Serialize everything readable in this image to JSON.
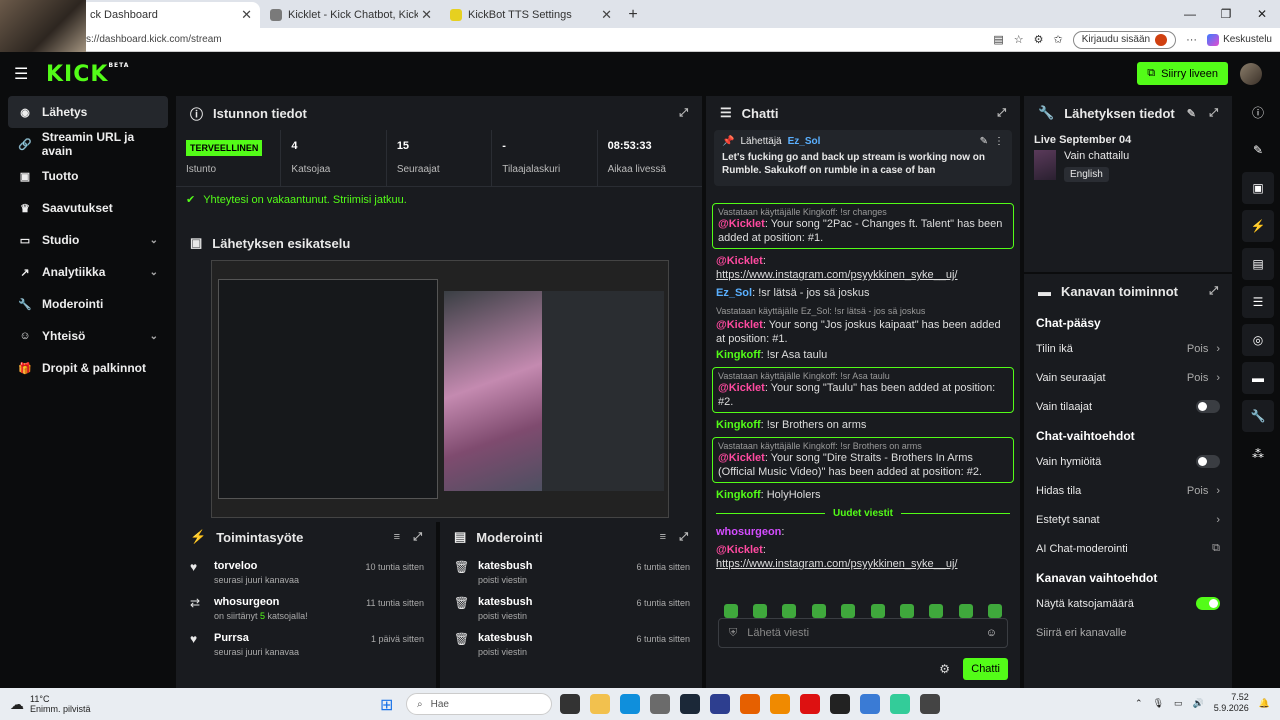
{
  "browser": {
    "tabs": [
      {
        "label": "ck Dashboard",
        "active": true
      },
      {
        "label": "Kicklet - Kick Chatbot, Kick Widge",
        "active": false
      },
      {
        "label": "KickBot TTS Settings",
        "active": false
      }
    ],
    "url": "s://dashboard.kick.com/stream",
    "signin_label": "Kirjaudu sisään",
    "copilot_label": "Keskustelu"
  },
  "topnav": {
    "logo": "KICK",
    "logo_sup": "BETA",
    "golive_label": "Siirry liveen"
  },
  "sidebar": {
    "items": [
      {
        "label": "Lähetys",
        "icon": "broadcast-icon",
        "active": true
      },
      {
        "label": "Streamin URL ja avain",
        "icon": "link-icon"
      },
      {
        "label": "Tuotto",
        "icon": "wallet-icon"
      },
      {
        "label": "Saavutukset",
        "icon": "trophy-icon"
      },
      {
        "label": "Studio",
        "icon": "studio-icon",
        "chevron": true
      },
      {
        "label": "Analytiikka",
        "icon": "analytics-icon",
        "chevron": true
      },
      {
        "label": "Moderointi",
        "icon": "wrench-icon"
      },
      {
        "label": "Yhteisö",
        "icon": "community-icon",
        "chevron": true
      },
      {
        "label": "Dropit & palkinnot",
        "icon": "gift-icon"
      }
    ]
  },
  "session": {
    "title": "Istunnon tiedot",
    "health_badge": "TERVEELLINEN",
    "health_label": "Istunto",
    "viewers_value": "4",
    "viewers_label": "Katsojaa",
    "followers_value": "15",
    "followers_label": "Seuraajat",
    "subs_value": "-",
    "subs_label": "Tilaajalaskuri",
    "live_time_value": "08:53:33",
    "live_time_label": "Aikaa livessä",
    "status_text": "Yhteytesi on vakaantunut. Striimisi jatkuu."
  },
  "preview": {
    "title": "Lähetyksen esikatselu"
  },
  "activity": {
    "title": "Toimintasyöte",
    "items": [
      {
        "name": "torveloo",
        "sub": "seurasi juuri kanavaa",
        "time": "10 tuntia sitten"
      },
      {
        "name": "whosurgeon",
        "sub_pre": "on siirtänyt ",
        "sub_count": "5",
        "sub_post": " katsojalla!",
        "time": "11 tuntia sitten"
      },
      {
        "name": "Purrsa",
        "sub": "seurasi juuri kanavaa",
        "time": "1 päivä sitten"
      }
    ]
  },
  "moderation": {
    "title": "Moderointi",
    "items": [
      {
        "name": "katesbush",
        "sub": "poisti viestin",
        "time": "6 tuntia sitten"
      },
      {
        "name": "katesbush",
        "sub": "poisti viestin",
        "time": "6 tuntia sitten"
      },
      {
        "name": "katesbush",
        "sub": "poisti viestin",
        "time": "6 tuntia sitten"
      }
    ]
  },
  "chat": {
    "title": "Chatti",
    "pinned_sender_label": "Lähettäjä",
    "pinned_sender": "Ez_Sol",
    "pinned_text": "Let's fucking go and back up stream is working now on Rumble. Sakukoff on rumble in a case of ban",
    "messages": [
      {
        "reply": "Vastataan käyttäjälle Kingkoff: !sr changes",
        "user": "@Kicklet",
        "text": ": Your song \"2Pac - Changes ft. Talent\" has been added at position: #1."
      },
      {
        "user": "@Kicklet",
        "link": "https://www.instagram.com/psyykkinen_syke__uj/"
      },
      {
        "user": "Ez_Sol",
        "text": ": !sr lätsä - jos sä joskus"
      },
      {
        "reply": "Vastataan käyttäjälle Ez_Sol: !sr lätsä - jos sä joskus",
        "user": "@Kicklet",
        "text": ": Your song \"Jos joskus kaipaat\" has been added at position: #1."
      },
      {
        "user": "Kingkoff",
        "text": ": !sr Asa taulu"
      },
      {
        "reply": "Vastataan käyttäjälle Kingkoff: !sr Asa taulu",
        "user": "@Kicklet",
        "text": ": Your song \"Taulu\" has been added at position: #2."
      },
      {
        "user": "Kingkoff",
        "text": ": !sr Brothers on arms"
      },
      {
        "reply": "Vastataan käyttäjälle Kingkoff: !sr Brothers on arms",
        "user": "@Kicklet",
        "text": ": Your song \"Dire Straits - Brothers In Arms (Official Music Video)\" has been added at position: #2."
      },
      {
        "user": "Kingkoff",
        "text": ": HolyHolers"
      }
    ],
    "new_messages_label": "Uudet viestit",
    "after": [
      {
        "user": "whosurgeon",
        "text": ":"
      },
      {
        "user": "@Kicklet",
        "link": "https://www.instagram.com/psyykkinen_syke__uj/"
      }
    ],
    "input_placeholder": "Lähetä viesti",
    "send_label": "Chatti"
  },
  "stream_info": {
    "title": "Lähetyksen tiedot",
    "live_title": "Live September 04",
    "category": "Vain chattailu",
    "language": "English"
  },
  "channel": {
    "title": "Kanavan toiminnot",
    "chat_access": "Chat-pääsy",
    "account_age": "Tilin ikä",
    "account_age_val": "Pois",
    "followers_only": "Vain seuraajat",
    "followers_only_val": "Pois",
    "subs_only": "Vain tilaajat",
    "chat_options": "Chat-vaihtoehdot",
    "emotes_only": "Vain hymiöitä",
    "slow_mode": "Hidas tila",
    "slow_mode_val": "Pois",
    "blocked_words": "Estetyt sanat",
    "ai_mod": "AI Chat-moderointi",
    "channel_options": "Kanavan vaihtoehdot",
    "show_viewers": "Näytä katsojamäärä",
    "move_channel": "Siirrä eri kanavalle"
  },
  "taskbar": {
    "temp": "11°C",
    "weather": "Enimm. pilvistä",
    "search_placeholder": "Hae",
    "time": "7.52",
    "date": "5.9.2026"
  },
  "colors": {
    "accent": "#53fc18",
    "mention": "#ff4aa0",
    "panel": "#191b1f"
  }
}
